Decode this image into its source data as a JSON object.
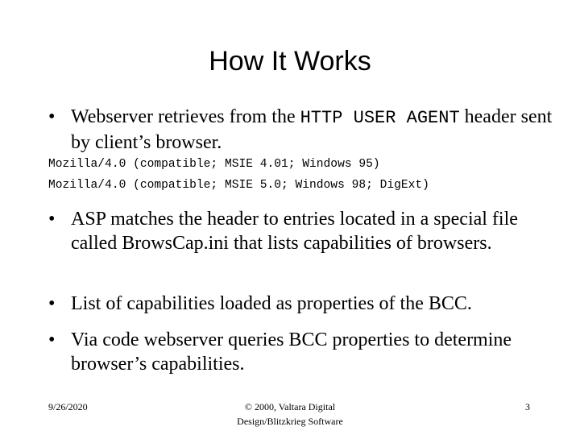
{
  "slide": {
    "title": "How It Works",
    "bullets": [
      {
        "pre": "Webserver retrieves from the ",
        "code": "HTTP USER AGENT",
        "post": " header sent by client’s browser."
      },
      {
        "text": "ASP matches the header to entries located in a special file called BrowsCap.ini that lists capabilities of browsers."
      },
      {
        "text": "List of capabilities loaded as properties of the BCC."
      },
      {
        "text": "Via code webserver queries BCC properties to determine browser’s capabilities."
      }
    ],
    "code_lines": [
      "Mozilla/4.0 (compatible; MSIE 4.01; Windows 95)",
      "Mozilla/4.0 (compatible; MSIE 5.0; Windows 98; DigExt)"
    ],
    "bullet_glyph": "•"
  },
  "footer": {
    "date": "9/26/2020",
    "copyright_line1": "© 2000, Valtara Digital",
    "copyright_line2": "Design/Blitzkrieg Software",
    "page_number": "3"
  }
}
